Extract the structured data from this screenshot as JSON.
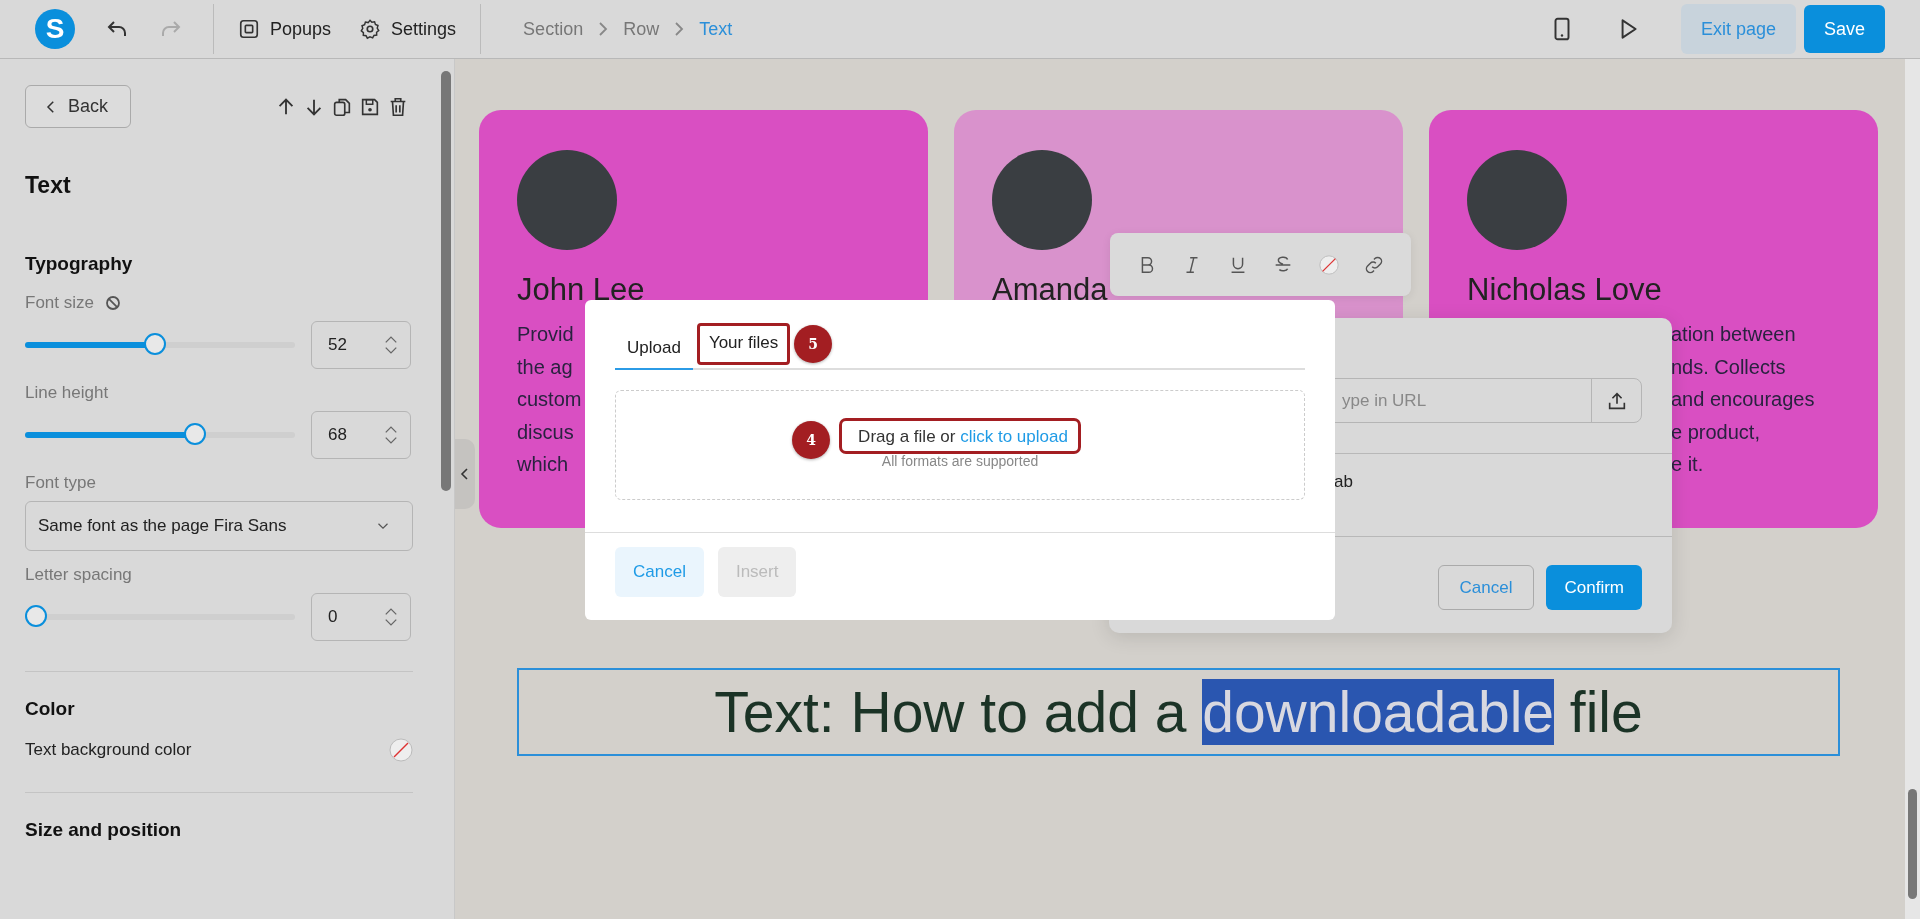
{
  "topbar": {
    "logo": "S",
    "undo_disabled": false,
    "redo_disabled": true,
    "menu": [
      {
        "kind": "popups",
        "label": "Popups"
      },
      {
        "kind": "settings",
        "label": "Settings"
      }
    ],
    "breadcrumbs": [
      {
        "label": "Section",
        "selected": false
      },
      {
        "label": "Row",
        "selected": false
      },
      {
        "label": "Text",
        "selected": true
      }
    ],
    "exit_button": "Exit page",
    "save_button": "Save"
  },
  "panel": {
    "back": "Back",
    "title": "Text",
    "typography": {
      "title": "Typography",
      "controls": [
        {
          "kind": "slider",
          "label": "Font size",
          "reset_icon": true,
          "level": 0.48,
          "value": "52"
        },
        {
          "kind": "slider",
          "label": "Line height",
          "level": 0.64,
          "value": "68"
        },
        {
          "kind": "select",
          "label": "Font type",
          "value": "Same font as the page Fira Sans"
        },
        {
          "kind": "slider",
          "label": "Letter spacing",
          "level": 0,
          "value": "0"
        }
      ]
    },
    "color": {
      "title": "Color",
      "label": "Text background color"
    },
    "size_title": "Size and position"
  },
  "canvas": {
    "cards": [
      {
        "name": "John Lee",
        "color": "#d94fc2",
        "lines": [
          "Provid",
          "the ag",
          "custom",
          "discus",
          "which"
        ]
      },
      {
        "name": "Amanda",
        "color": "#d992cc"
      },
      {
        "name": "Nicholas Love",
        "color": "#d94fc2",
        "lines": [
          "ation between",
          "nds. Collects",
          "and encourages",
          "e product,",
          "e it."
        ]
      }
    ],
    "heading": {
      "text": "Text: How to add a ",
      "selection": "downloadable",
      "text_after": " file"
    }
  },
  "link_dialog": {
    "url_placeholder": "ype in URL",
    "option_text": "ab",
    "cancel": "Cancel",
    "confirm": "Confirm"
  },
  "upload_dialog": {
    "tabs": [
      {
        "label": "Upload",
        "selected": true
      },
      {
        "label": "Your files",
        "selected": false,
        "annotation": "5"
      }
    ],
    "prompt": "Drag a file or ",
    "prompt_link": "click to upload",
    "hint": "All formats are supported",
    "prompt_annotation": "4",
    "cancel": "Cancel",
    "insert": {
      "label": "Insert",
      "disabled": true
    }
  }
}
